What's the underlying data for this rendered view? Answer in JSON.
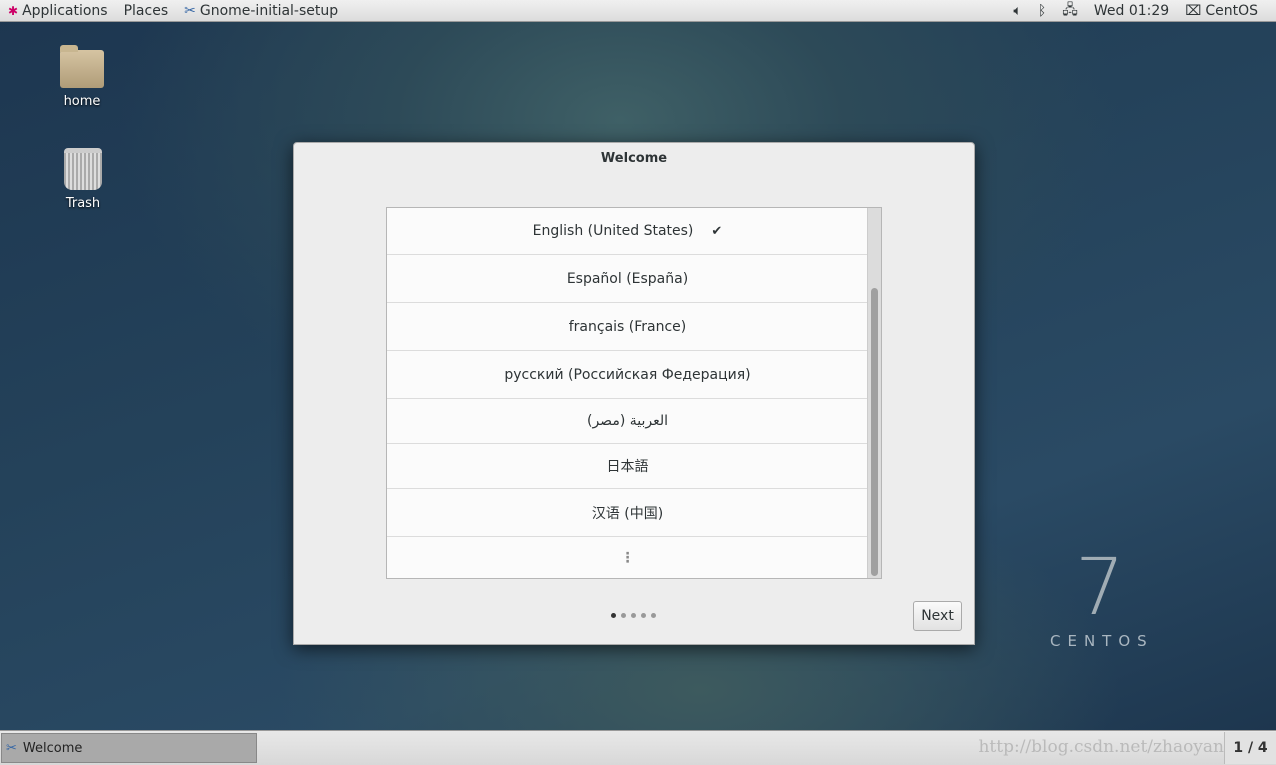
{
  "topbar": {
    "applications": "Applications",
    "places": "Places",
    "app_name": "Gnome-initial-setup",
    "clock": "Wed 01:29",
    "user": "CentOS"
  },
  "desktop": {
    "icons": [
      {
        "label": "home",
        "icon": "home-folder-icon"
      },
      {
        "label": "Trash",
        "icon": "trash-icon"
      }
    ]
  },
  "dialog": {
    "title": "Welcome",
    "languages": [
      {
        "label": "English (United States)",
        "selected": true
      },
      {
        "label": "Español (España)"
      },
      {
        "label": "français (France)"
      },
      {
        "label": "русский (Российская Федерация)"
      },
      {
        "label": "العربية (مصر)"
      },
      {
        "label": "日本語"
      },
      {
        "label": "汉语 (中国)"
      },
      {
        "label": "⋮"
      }
    ],
    "check": "✔",
    "pages": 5,
    "current_page": 1,
    "next_label": "Next"
  },
  "branding": {
    "version": "7",
    "name": "CENTOS"
  },
  "taskbar": {
    "task_label": "Welcome",
    "watermark": "http://blog.csdn.net/zhaoyan",
    "workspace": "1 / 4"
  }
}
